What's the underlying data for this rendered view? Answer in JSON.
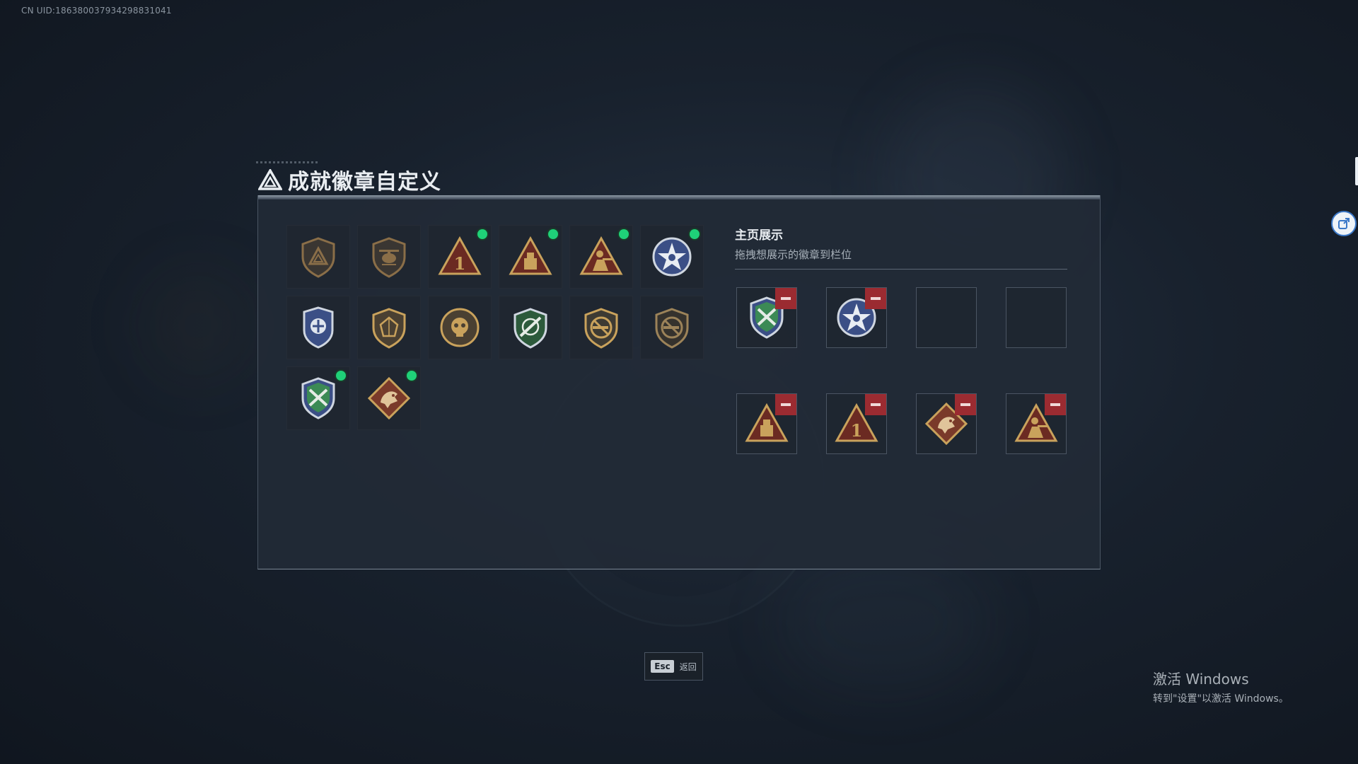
{
  "uid": "CN UID:1863800379342988310 41",
  "uid_text": "CN UID:186380037934298831041",
  "title": "成就徽章自定义",
  "showcase": {
    "title": "主页展示",
    "subtitle": "拖拽想展示的徽章到栏位"
  },
  "badges": [
    {
      "icon": "triangle-shield-badge-icon",
      "new": false
    },
    {
      "icon": "helicopter-shield-badge-icon",
      "new": false
    },
    {
      "icon": "number-one-triangle-badge-icon",
      "new": true
    },
    {
      "icon": "supply-box-triangle-badge-icon",
      "new": true
    },
    {
      "icon": "soldier-triangle-badge-icon",
      "new": true
    },
    {
      "icon": "star-emblem-badge-icon",
      "new": true
    },
    {
      "icon": "police-shield-badge-icon",
      "new": false
    },
    {
      "icon": "gem-shield-badge-icon",
      "new": false
    },
    {
      "icon": "skull-seal-badge-icon",
      "new": false
    },
    {
      "icon": "green-rifle-shield-badge-icon",
      "new": false
    },
    {
      "icon": "no-rifle-shield-badge-icon",
      "new": false
    },
    {
      "icon": "no-rifle-shield-dark-badge-icon",
      "new": false
    },
    {
      "icon": "rifle-cross-shield-badge-icon",
      "new": true
    },
    {
      "icon": "dragon-diamond-badge-icon",
      "new": true
    }
  ],
  "showcase_slots": [
    {
      "icon": "rifle-cross-shield-badge-icon",
      "filled": true
    },
    {
      "icon": "star-emblem-badge-icon",
      "filled": true
    },
    {
      "icon": "",
      "filled": false
    },
    {
      "icon": "",
      "filled": false
    },
    {
      "icon": "supply-box-triangle-badge-icon",
      "filled": true
    },
    {
      "icon": "number-one-triangle-badge-icon",
      "filled": true
    },
    {
      "icon": "dragon-diamond-badge-icon",
      "filled": true
    },
    {
      "icon": "soldier-triangle-badge-icon",
      "filled": true
    }
  ],
  "esc": {
    "key": "Esc",
    "label": "返回"
  },
  "windows_watermark": {
    "line1": "激活 Windows",
    "line2": "转到\"设置\"以激活 Windows。"
  },
  "colors": {
    "new_dot": "#1fd178",
    "remove": "#9b2b31",
    "gold": "#c9a25c",
    "bronze": "#8a6e48",
    "navy": "#3b4f86",
    "green": "#3c8a55"
  }
}
